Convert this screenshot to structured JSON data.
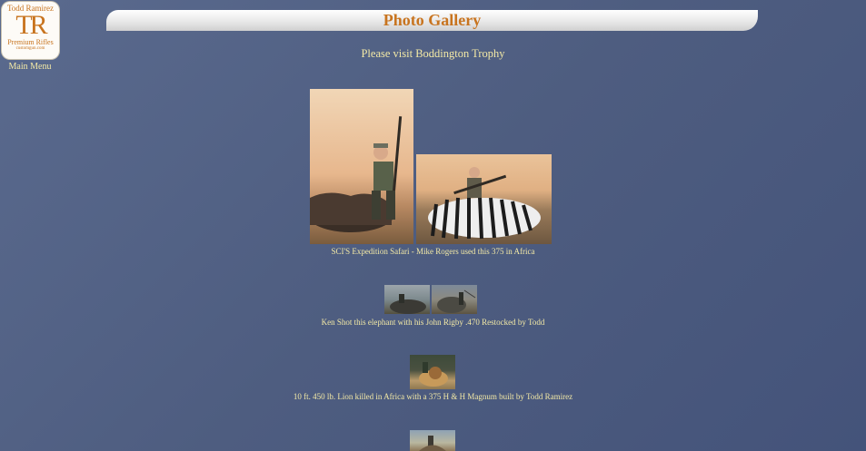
{
  "logo": {
    "name": "Todd Ramirez",
    "monogram": "TR",
    "tagline": "Premium Rifles",
    "url": "customgun.com"
  },
  "nav": {
    "main_menu": "Main Menu"
  },
  "header": {
    "title": "Photo Gallery"
  },
  "intro": {
    "text": "Please visit Boddington Trophy"
  },
  "gallery": [
    {
      "caption": "SCI'S Expedition Safari - Mike Rogers used this 375 in Africa"
    },
    {
      "caption": "Ken Shot this elephant with his John Rigby .470 Restocked by Todd"
    },
    {
      "caption": "10 ft. 450 lb. Lion killed in Africa with a 375 H & H Magnum built by Todd Ramirez"
    }
  ],
  "colors": {
    "accent": "#c8741f",
    "text": "#f3e9a6",
    "background": "#4e5d80"
  }
}
